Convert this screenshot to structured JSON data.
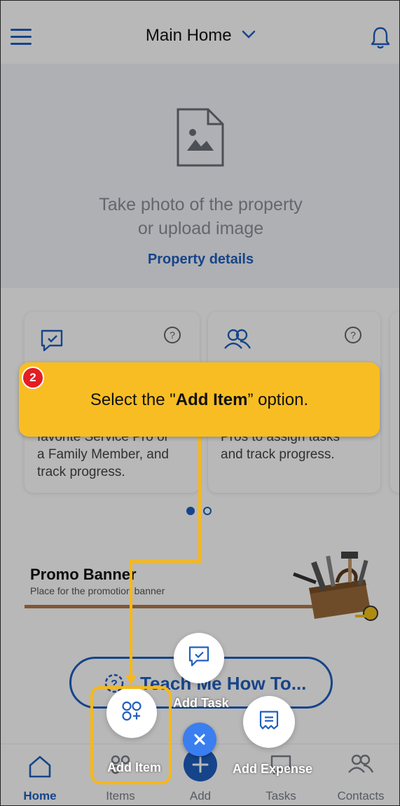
{
  "header": {
    "title": "Main Home",
    "menu_icon": "hamburger-icon",
    "notification_icon": "bell-icon"
  },
  "hero": {
    "line1": "Take photo of the property",
    "line2": "or upload image",
    "link": "Property details"
  },
  "cards": [
    {
      "text_line1": "favorite Service Pro or",
      "text_line2": "a Family Member, and",
      "text_line3": "track progress."
    },
    {
      "text_line1": "Pros to assign tasks",
      "text_line2": "and track progress."
    }
  ],
  "promo": {
    "title": "Promo Banner",
    "subtitle": "Place for the promotion banner"
  },
  "teach_button": {
    "label": "Teach Me How To..."
  },
  "fab": {
    "add_task": "Add Task",
    "add_item": "Add Item",
    "add_expense": "Add Expense"
  },
  "nav": {
    "items": [
      {
        "label": "Home",
        "active": true
      },
      {
        "label": "Items"
      },
      {
        "label": "Add"
      },
      {
        "label": "Tasks"
      },
      {
        "label": "Contacts"
      }
    ]
  },
  "callout": {
    "step": "2",
    "text_before": "Select the \"",
    "text_bold": "Add Item",
    "text_after": "” option."
  },
  "colors": {
    "brand_blue": "#1f5fbf",
    "callout_yellow": "#f8bd22",
    "badge_red": "#e31e24"
  }
}
